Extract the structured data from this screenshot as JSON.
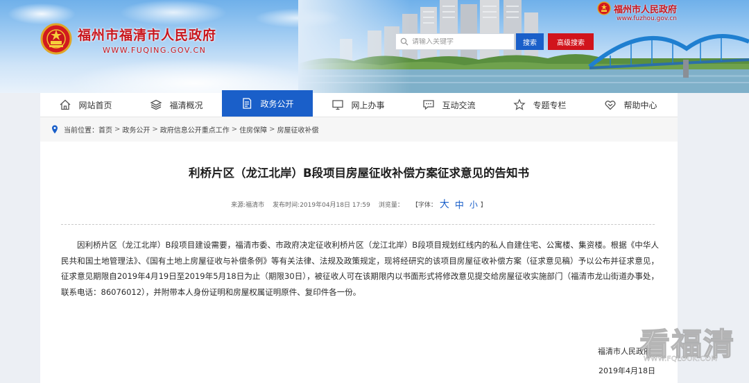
{
  "header": {
    "site_title": "福州市福清市人民政府",
    "site_url": "WWW.FUQING.GOV.CN",
    "gov_name": "福州市人民政府",
    "gov_url": "www.fuzhou.gov.cn",
    "search_placeholder": "请输入关键字",
    "search_label": "搜索",
    "advanced_search_label": "高级搜索"
  },
  "nav": {
    "items": [
      {
        "label": "网站首页",
        "icon": "home-icon"
      },
      {
        "label": "福清概况",
        "icon": "layers-icon"
      },
      {
        "label": "政务公开",
        "icon": "document-icon",
        "active": true
      },
      {
        "label": "网上办事",
        "icon": "monitor-icon"
      },
      {
        "label": "互动交流",
        "icon": "chat-icon"
      },
      {
        "label": "专题专栏",
        "icon": "star-icon"
      },
      {
        "label": "帮助中心",
        "icon": "handshake-icon"
      }
    ],
    "active_color": "#1a5fc9"
  },
  "breadcrumb": {
    "prefix": "当前位置：",
    "items": [
      "首页",
      "政务公开",
      "政府信息公开重点工作",
      "住房保障",
      "房屋征收补偿"
    ],
    "separator": ">"
  },
  "article": {
    "title": "利桥片区（龙江北岸）B段项目房屋征收补偿方案征求意见的告知书",
    "source_label": "来源:",
    "source": "福清市",
    "published_label": "发布时间:",
    "published": "2019年04月18日 17:59",
    "views_label": "浏览量：",
    "font_label": "【字体：",
    "font_big": "大",
    "font_mid": "中",
    "font_small": "小",
    "font_close": "】",
    "body": "因利桥片区（龙江北岸）B段项目建设需要，福清市委、市政府决定征收利桥片区（龙江北岸）B段项目规划红线内的私人自建住宅、公寓楼、集资楼。根据《中华人民共和国土地管理法》、《国有土地上房屋征收与补偿条例》等有关法律、法规及政策规定，现将经研究的该项目房屋征收补偿方案（征求意见稿）予以公布并征求意见，征求意见期限自2019年4月19日至2019年5月18日为止（期限30日），被征收人可在该期限内以书面形式将修改意见提交给房屋征收实施部门（福清市龙山街道办事处，联系电话：86076012），并附带本人身份证明和房屋权属证明原件、复印件各一份。",
    "signature_org": "福清市人民政府",
    "signature_date": "2019年4月18日"
  },
  "watermark": {
    "text": "看福清",
    "url": "WWW.FQLOOK.COM"
  },
  "colors": {
    "brand_red": "#c8161d",
    "brand_blue": "#1a5fc9"
  }
}
